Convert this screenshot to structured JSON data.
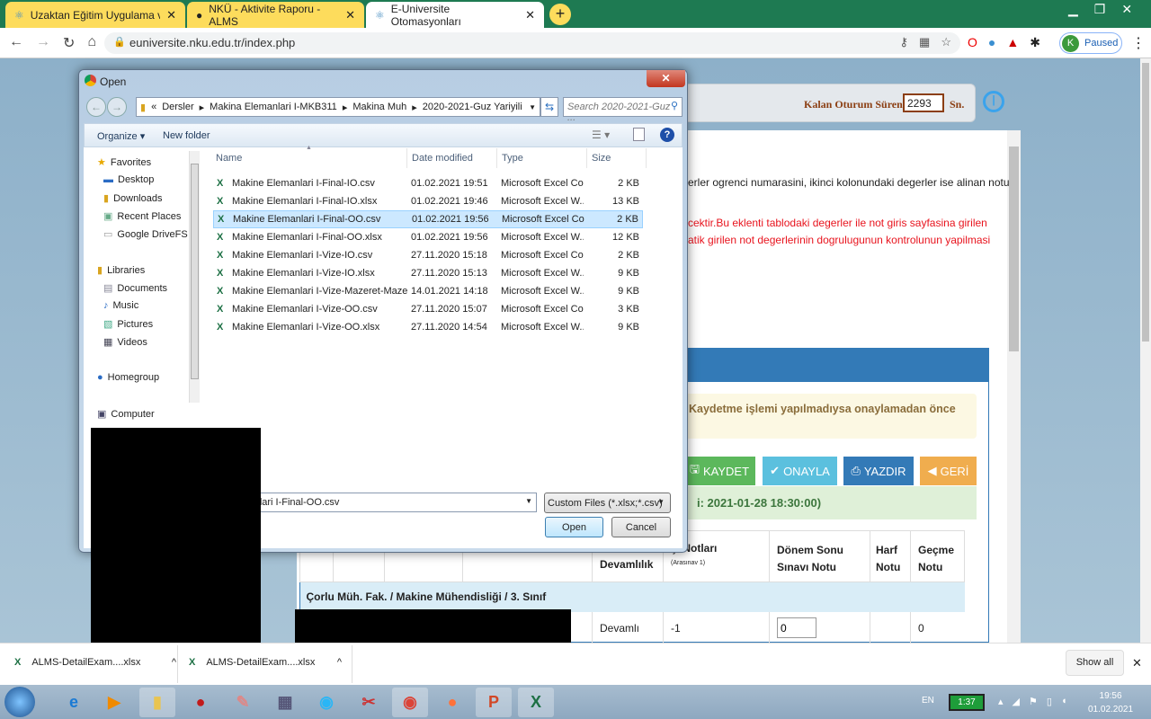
{
  "browser": {
    "tabs": [
      {
        "title": "Uzaktan Eğitim Uygulama ve Ara",
        "active": false
      },
      {
        "title": "NKÜ - Aktivite Raporu - ALMS",
        "active": false
      },
      {
        "title": "E-Universite Otomasyonları",
        "active": true
      }
    ],
    "new_tab": "+",
    "url": "euniversite.nku.edu.tr/index.php",
    "profile_label": "Paused",
    "profile_initial": "K",
    "colors": {
      "tabbar": "#1e7a52",
      "inactive_tab": "#fddc5c"
    }
  },
  "page": {
    "session_label": "Kalan Oturum Süreniz",
    "session_value": "2293",
    "session_unit": "Sn.",
    "info_line": "erler ogrenci numarasini, ikinci kolonundaki degerler ise alinan notu",
    "warn_line1": "cektir.Bu eklenti tablodaki degerler ile not giris sayfasina girilen",
    "warn_line2": "atik girilen not degerlerinin dogrulugunun kontrolunun yapilmasi",
    "alert": "Kaydetme işlemi yapılmadıysa onaylamadan önce",
    "buttons": {
      "save": "KAYDET",
      "approve": "ONAYLA",
      "print": "YAZDIR",
      "back": "GERİ"
    },
    "deadline": "i: 2021-01-28 18:30:00)",
    "table": {
      "headers": [
        "Devamlılık",
        "çi Notları",
        "Dönem Sonu Sınavı Notu",
        "Harf Notu",
        "Geçme Notu"
      ],
      "sub_header": "(Arasınav 1)",
      "section": "Çorlu Müh. Fak. / Makine Mühendisliği / 3. Sınıf",
      "rows": [
        {
          "attendance": "Devamlı",
          "midterm": "-1",
          "final": "0",
          "letter": "",
          "pass": "0"
        }
      ]
    }
  },
  "dialog": {
    "title": "Open",
    "breadcrumb": [
      "«",
      "Dersler",
      "Makina Elemanlari I-MKB311",
      "Makina Muh",
      "2020-2021-Guz Yariyili"
    ],
    "search_placeholder": "Search 2020-2021-Guz ...",
    "organize": "Organize",
    "new_folder": "New folder",
    "nav": {
      "favorites": "Favorites",
      "desktop": "Desktop",
      "downloads": "Downloads",
      "recent": "Recent Places",
      "gdrive": "Google DriveFS",
      "libraries": "Libraries",
      "documents": "Documents",
      "music": "Music",
      "pictures": "Pictures",
      "videos": "Videos",
      "homegroup": "Homegroup",
      "computer": "Computer"
    },
    "columns": [
      "Name",
      "Date modified",
      "Type",
      "Size"
    ],
    "files": [
      {
        "name": "Makine Elemanlari I-Final-IO.csv",
        "date": "01.02.2021 19:51",
        "type": "Microsoft Excel Co...",
        "size": "2 KB"
      },
      {
        "name": "Makine Elemanlari I-Final-IO.xlsx",
        "date": "01.02.2021 19:46",
        "type": "Microsoft Excel W...",
        "size": "13 KB"
      },
      {
        "name": "Makine Elemanlari I-Final-OO.csv",
        "date": "01.02.2021 19:56",
        "type": "Microsoft Excel Co...",
        "size": "2 KB",
        "selected": true
      },
      {
        "name": "Makine Elemanlari I-Final-OO.xlsx",
        "date": "01.02.2021 19:56",
        "type": "Microsoft Excel W...",
        "size": "12 KB"
      },
      {
        "name": "Makine Elemanlari I-Vize-IO.csv",
        "date": "27.11.2020 15:18",
        "type": "Microsoft Excel Co...",
        "size": "2 KB"
      },
      {
        "name": "Makine Elemanlari I-Vize-IO.xlsx",
        "date": "27.11.2020 15:13",
        "type": "Microsoft Excel W...",
        "size": "9 KB"
      },
      {
        "name": "Makine Elemanlari I-Vize-Mazeret-Mazer...",
        "date": "14.01.2021 14:18",
        "type": "Microsoft Excel W...",
        "size": "9 KB"
      },
      {
        "name": "Makine Elemanlari I-Vize-OO.csv",
        "date": "27.11.2020 15:07",
        "type": "Microsoft Excel Co...",
        "size": "3 KB"
      },
      {
        "name": "Makine Elemanlari I-Vize-OO.xlsx",
        "date": "27.11.2020 14:54",
        "type": "Microsoft Excel W...",
        "size": "9 KB"
      }
    ],
    "filename": "Makine Elemanlari I-Final-OO.csv",
    "filter": "Custom Files (*.xlsx;*.csv)",
    "open": "Open",
    "cancel": "Cancel"
  },
  "downloads": {
    "items": [
      "ALMS-DetailExam....xlsx",
      "ALMS-DetailExam....xlsx"
    ],
    "show_all": "Show all"
  },
  "taskbar": {
    "lang": "EN",
    "battery": "1:37",
    "time": "19:56",
    "date": "01.02.2021"
  }
}
